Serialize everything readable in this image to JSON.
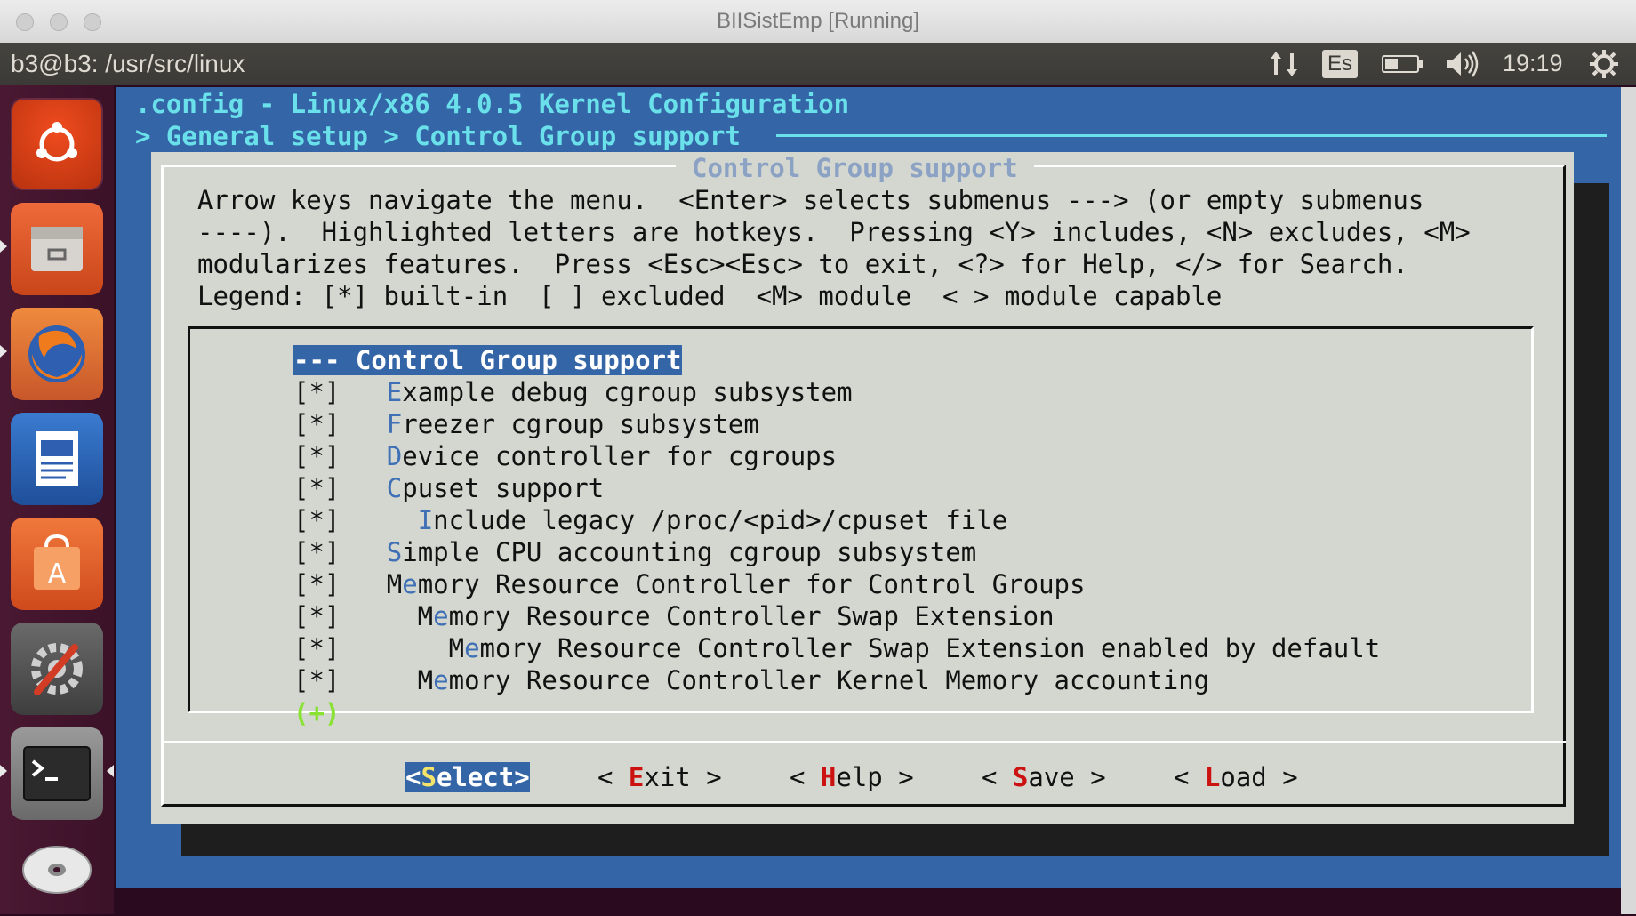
{
  "window": {
    "title": "BIISistEmp [Running]"
  },
  "panel": {
    "title": "b3@b3: /usr/src/linux",
    "keyboard_layout": "Es",
    "clock": "19:19",
    "icons": [
      "network-icon",
      "keyboard-layout-icon",
      "battery-icon",
      "volume-icon",
      "settings-gear-icon"
    ]
  },
  "launcher": {
    "items": [
      "ubuntu-dash-icon",
      "files-icon",
      "firefox-icon",
      "writer-icon",
      "software-center-icon",
      "system-settings-icon",
      "terminal-icon",
      "dvd-icon"
    ]
  },
  "menuconfig": {
    "config_title": ".config - Linux/x86 4.0.5 Kernel Configuration",
    "breadcrumb": "> General setup > Control Group support",
    "dialog_title": "Control Group support",
    "help_lines": [
      "Arrow keys navigate the menu.  <Enter> selects submenus ---> (or empty submenus",
      "----).  Highlighted letters are hotkeys.  Pressing <Y> includes, <N> excludes, <M>",
      "modularizes features.  Press <Esc><Esc> to exit, <?> for Help, </> for Search.",
      "Legend: [*] built-in  [ ] excluded  <M> module  < > module capable"
    ],
    "items": [
      {
        "prefix": "-",
        "hotkey": "-",
        "rest": "- Control Group support",
        "selected": true
      },
      {
        "prefix": "[*]   ",
        "hotkey": "E",
        "rest": "xample debug cgroup subsystem"
      },
      {
        "prefix": "[*]   ",
        "hotkey": "F",
        "rest": "reezer cgroup subsystem"
      },
      {
        "prefix": "[*]   ",
        "hotkey": "D",
        "rest": "evice controller for cgroups"
      },
      {
        "prefix": "[*]   ",
        "hotkey": "C",
        "rest": "puset support"
      },
      {
        "prefix": "[*]     ",
        "hotkey": "I",
        "rest": "nclude legacy /proc/<pid>/cpuset file"
      },
      {
        "prefix": "[*]   ",
        "hotkey": "S",
        "rest": "imple CPU accounting cgroup subsystem"
      },
      {
        "prefix": "[*]   M",
        "hotkey": "e",
        "rest": "mory Resource Controller for Control Groups"
      },
      {
        "prefix": "[*]     M",
        "hotkey": "e",
        "rest": "mory Resource Controller Swap Extension"
      },
      {
        "prefix": "[*]       M",
        "hotkey": "e",
        "rest": "mory Resource Controller Swap Extension enabled by default"
      },
      {
        "prefix": "[*]     M",
        "hotkey": "e",
        "rest": "mory Resource Controller Kernel Memory accounting"
      }
    ],
    "more_indicator": "(+)",
    "buttons": [
      {
        "pre": "<",
        "hotkey": "S",
        "post": "elect>",
        "active": true
      },
      {
        "pre": "< ",
        "hotkey": "E",
        "post": "xit >",
        "active": false
      },
      {
        "pre": "< ",
        "hotkey": "H",
        "post": "elp >",
        "active": false
      },
      {
        "pre": "< ",
        "hotkey": "S",
        "post": "ave >",
        "active": false
      },
      {
        "pre": "< ",
        "hotkey": "L",
        "post": "oad >",
        "active": false
      }
    ]
  }
}
